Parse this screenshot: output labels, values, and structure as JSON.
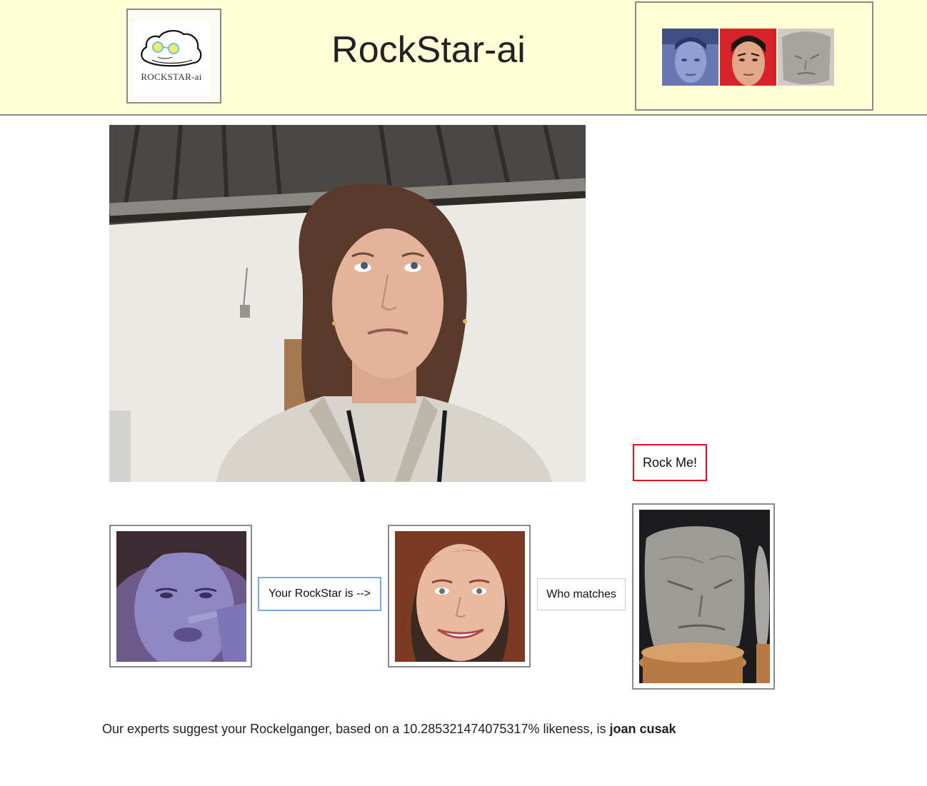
{
  "app": {
    "title": "RockStar-ai",
    "logo_text": "ROCKSTAR-ai"
  },
  "header_thumbnails": [
    {
      "name": "spock-blue-thumb",
      "tone": "#6d80b4"
    },
    {
      "name": "spock-red-thumb",
      "tone": "#d8262c"
    },
    {
      "name": "rock-face-thumb",
      "tone": "#a9a8a2"
    }
  ],
  "main": {
    "rock_button_label": "Rock Me!",
    "your_rockstar_label": "Your RockStar is -->",
    "who_matches_label": "Who matches",
    "result": {
      "prefix": "Our experts suggest your Rockelganger, based on a",
      "likeness": "10.285321474075317%",
      "middle": "likeness, is",
      "name": "joan cusak"
    }
  },
  "colors": {
    "header_bg": "#ffffd8",
    "frame_border": "#8a8a8a",
    "rock_button_border": "#e0141e",
    "focus_border": "#7aa7e6"
  }
}
